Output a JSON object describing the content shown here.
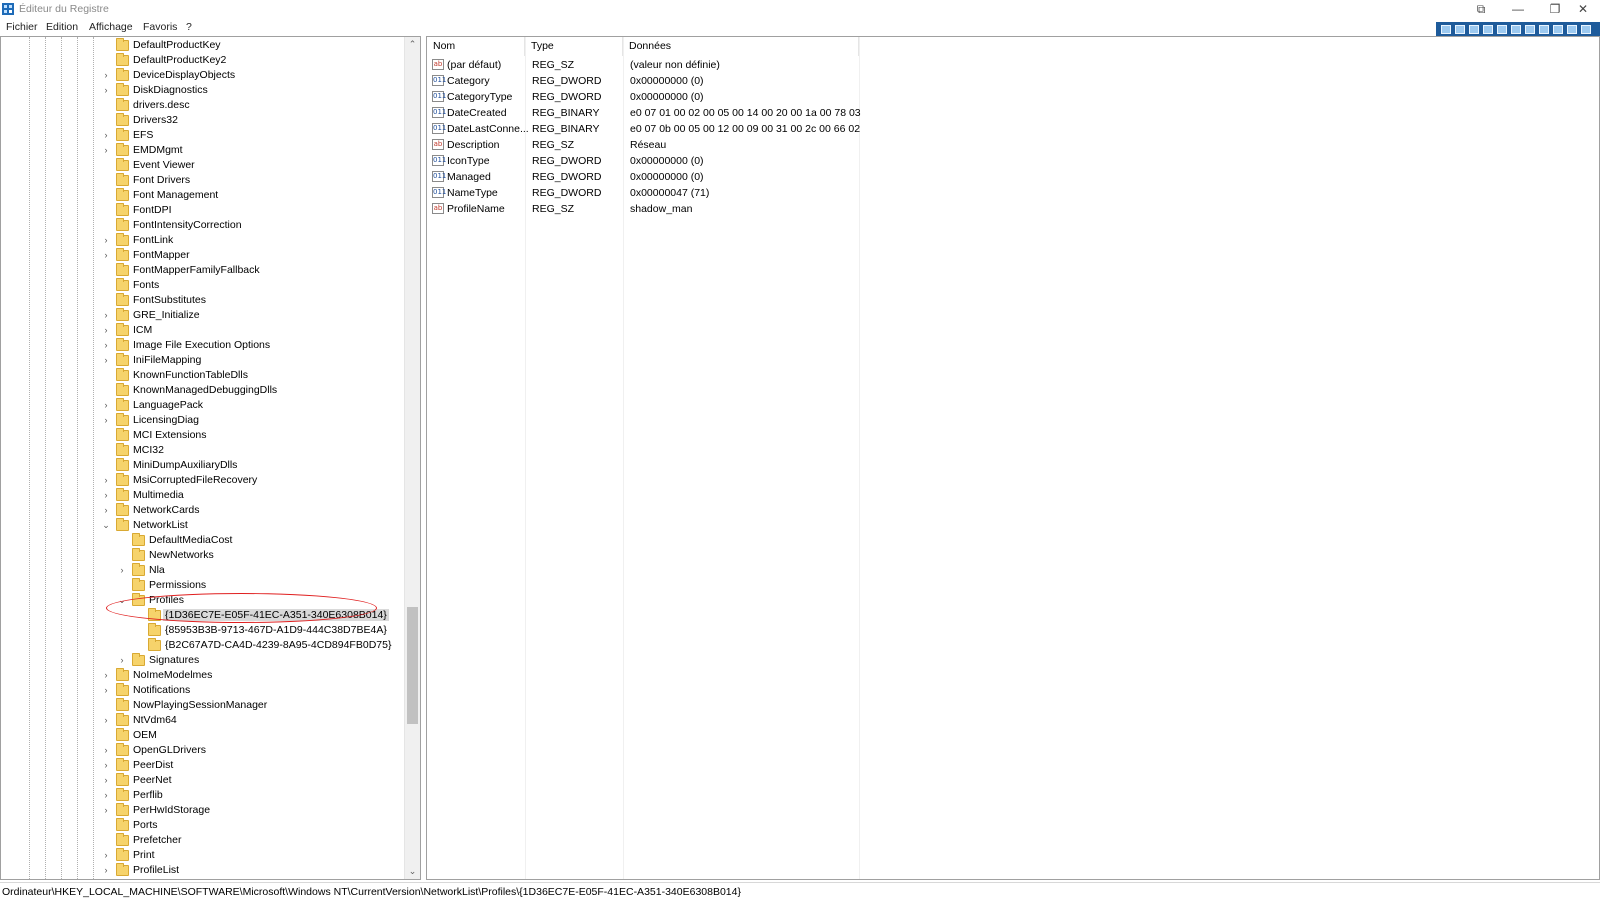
{
  "window": {
    "title": "Éditeur du Registre",
    "controls": {
      "pin": "⧉",
      "minimize": "—",
      "restore": "❐",
      "close": "✕"
    }
  },
  "menu": [
    "Fichier",
    "Edition",
    "Affichage",
    "Favoris",
    "?"
  ],
  "tree": {
    "items": [
      {
        "label": "DefaultProductKey",
        "depth": 0,
        "expand": ""
      },
      {
        "label": "DefaultProductKey2",
        "depth": 0,
        "expand": ""
      },
      {
        "label": "DeviceDisplayObjects",
        "depth": 0,
        "expand": "collapsed"
      },
      {
        "label": "DiskDiagnostics",
        "depth": 0,
        "expand": "collapsed"
      },
      {
        "label": "drivers.desc",
        "depth": 0,
        "expand": ""
      },
      {
        "label": "Drivers32",
        "depth": 0,
        "expand": ""
      },
      {
        "label": "EFS",
        "depth": 0,
        "expand": "collapsed"
      },
      {
        "label": "EMDMgmt",
        "depth": 0,
        "expand": "collapsed"
      },
      {
        "label": "Event Viewer",
        "depth": 0,
        "expand": ""
      },
      {
        "label": "Font Drivers",
        "depth": 0,
        "expand": ""
      },
      {
        "label": "Font Management",
        "depth": 0,
        "expand": ""
      },
      {
        "label": "FontDPI",
        "depth": 0,
        "expand": ""
      },
      {
        "label": "FontIntensityCorrection",
        "depth": 0,
        "expand": ""
      },
      {
        "label": "FontLink",
        "depth": 0,
        "expand": "collapsed"
      },
      {
        "label": "FontMapper",
        "depth": 0,
        "expand": "collapsed"
      },
      {
        "label": "FontMapperFamilyFallback",
        "depth": 0,
        "expand": ""
      },
      {
        "label": "Fonts",
        "depth": 0,
        "expand": ""
      },
      {
        "label": "FontSubstitutes",
        "depth": 0,
        "expand": ""
      },
      {
        "label": "GRE_Initialize",
        "depth": 0,
        "expand": "collapsed"
      },
      {
        "label": "ICM",
        "depth": 0,
        "expand": "collapsed"
      },
      {
        "label": "Image File Execution Options",
        "depth": 0,
        "expand": "collapsed"
      },
      {
        "label": "IniFileMapping",
        "depth": 0,
        "expand": "collapsed"
      },
      {
        "label": "KnownFunctionTableDlls",
        "depth": 0,
        "expand": ""
      },
      {
        "label": "KnownManagedDebuggingDlls",
        "depth": 0,
        "expand": ""
      },
      {
        "label": "LanguagePack",
        "depth": 0,
        "expand": "collapsed"
      },
      {
        "label": "LicensingDiag",
        "depth": 0,
        "expand": "collapsed"
      },
      {
        "label": "MCI Extensions",
        "depth": 0,
        "expand": ""
      },
      {
        "label": "MCI32",
        "depth": 0,
        "expand": ""
      },
      {
        "label": "MiniDumpAuxiliaryDlls",
        "depth": 0,
        "expand": ""
      },
      {
        "label": "MsiCorruptedFileRecovery",
        "depth": 0,
        "expand": "collapsed"
      },
      {
        "label": "Multimedia",
        "depth": 0,
        "expand": "collapsed"
      },
      {
        "label": "NetworkCards",
        "depth": 0,
        "expand": "collapsed"
      },
      {
        "label": "NetworkList",
        "depth": 0,
        "expand": "expanded"
      },
      {
        "label": "DefaultMediaCost",
        "depth": 1,
        "expand": ""
      },
      {
        "label": "NewNetworks",
        "depth": 1,
        "expand": ""
      },
      {
        "label": "Nla",
        "depth": 1,
        "expand": "collapsed"
      },
      {
        "label": "Permissions",
        "depth": 1,
        "expand": ""
      },
      {
        "label": "Profiles",
        "depth": 1,
        "expand": "expanded"
      },
      {
        "label": "{1D36EC7E-E05F-41EC-A351-340E6308B014}",
        "depth": 2,
        "expand": "",
        "selected": true
      },
      {
        "label": "{85953B3B-9713-467D-A1D9-444C38D7BE4A}",
        "depth": 2,
        "expand": ""
      },
      {
        "label": "{B2C67A7D-CA4D-4239-8A95-4CD894FB0D75}",
        "depth": 2,
        "expand": ""
      },
      {
        "label": "Signatures",
        "depth": 1,
        "expand": "collapsed"
      },
      {
        "label": "NoImeModelmes",
        "depth": 0,
        "expand": "collapsed"
      },
      {
        "label": "Notifications",
        "depth": 0,
        "expand": "collapsed"
      },
      {
        "label": "NowPlayingSessionManager",
        "depth": 0,
        "expand": ""
      },
      {
        "label": "NtVdm64",
        "depth": 0,
        "expand": "collapsed"
      },
      {
        "label": "OEM",
        "depth": 0,
        "expand": ""
      },
      {
        "label": "OpenGLDrivers",
        "depth": 0,
        "expand": "collapsed"
      },
      {
        "label": "PeerDist",
        "depth": 0,
        "expand": "collapsed"
      },
      {
        "label": "PeerNet",
        "depth": 0,
        "expand": "collapsed"
      },
      {
        "label": "Perflib",
        "depth": 0,
        "expand": "collapsed"
      },
      {
        "label": "PerHwIdStorage",
        "depth": 0,
        "expand": "collapsed"
      },
      {
        "label": "Ports",
        "depth": 0,
        "expand": ""
      },
      {
        "label": "Prefetcher",
        "depth": 0,
        "expand": ""
      },
      {
        "label": "Print",
        "depth": 0,
        "expand": "collapsed"
      },
      {
        "label": "ProfileList",
        "depth": 0,
        "expand": "collapsed"
      }
    ],
    "scroll_up": "⌃",
    "scroll_down": "⌄"
  },
  "list": {
    "columns": [
      "Nom",
      "Type",
      "Données"
    ],
    "rows": [
      {
        "icon": "string-value-icon",
        "glyph": "ab",
        "name": "(par défaut)",
        "type": "REG_SZ",
        "data": "(valeur non définie)"
      },
      {
        "icon": "binary-value-icon",
        "glyph": "011",
        "name": "Category",
        "type": "REG_DWORD",
        "data": "0x00000000 (0)"
      },
      {
        "icon": "binary-value-icon",
        "glyph": "011",
        "name": "CategoryType",
        "type": "REG_DWORD",
        "data": "0x00000000 (0)"
      },
      {
        "icon": "binary-value-icon",
        "glyph": "011",
        "name": "DateCreated",
        "type": "REG_BINARY",
        "data": "e0 07 01 00 02 00 05 00 14 00 20 00 1a 00 78 03"
      },
      {
        "icon": "binary-value-icon",
        "glyph": "011",
        "name": "DateLastConne...",
        "type": "REG_BINARY",
        "data": "e0 07 0b 00 05 00 12 00 09 00 31 00 2c 00 66 02"
      },
      {
        "icon": "string-value-icon",
        "glyph": "ab",
        "name": "Description",
        "type": "REG_SZ",
        "data": "Réseau"
      },
      {
        "icon": "binary-value-icon",
        "glyph": "011",
        "name": "IconType",
        "type": "REG_DWORD",
        "data": "0x00000000 (0)"
      },
      {
        "icon": "binary-value-icon",
        "glyph": "011",
        "name": "Managed",
        "type": "REG_DWORD",
        "data": "0x00000000 (0)"
      },
      {
        "icon": "binary-value-icon",
        "glyph": "011",
        "name": "NameType",
        "type": "REG_DWORD",
        "data": "0x00000047 (71)"
      },
      {
        "icon": "string-value-icon",
        "glyph": "ab",
        "name": "ProfileName",
        "type": "REG_SZ",
        "data": "shadow_man"
      }
    ]
  },
  "status": {
    "path": "Ordinateur\\HKEY_LOCAL_MACHINE\\SOFTWARE\\Microsoft\\Windows NT\\CurrentVersion\\NetworkList\\Profiles\\{1D36EC7E-E05F-41EC-A351-340E6308B014}"
  },
  "colors": {
    "selection": "#d9d9d9",
    "annotation": "#e02020",
    "toolbar": "#1e5b9b"
  }
}
